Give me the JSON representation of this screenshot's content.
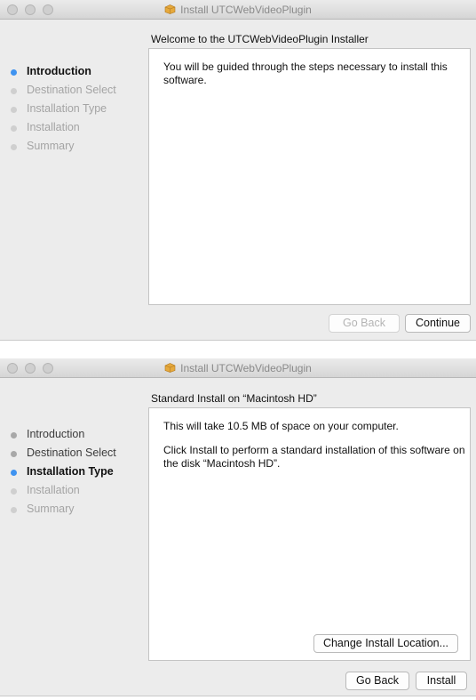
{
  "window1": {
    "title": "Install UTCWebVideoPlugin",
    "steps": [
      "Introduction",
      "Destination Select",
      "Installation Type",
      "Installation",
      "Summary"
    ],
    "pane_title": "Welcome to the UTCWebVideoPlugin Installer",
    "body_text": "You will be guided through the steps necessary to install this software.",
    "back_label": "Go Back",
    "continue_label": "Continue"
  },
  "window2": {
    "title": "Install UTCWebVideoPlugin",
    "steps": [
      "Introduction",
      "Destination Select",
      "Installation Type",
      "Installation",
      "Summary"
    ],
    "pane_title": "Standard Install on “Macintosh HD”",
    "body_text_1": "This will take 10.5 MB of space on your computer.",
    "body_text_2": "Click Install to perform a standard installation of this software on the disk “Macintosh HD”.",
    "change_location_label": "Change Install Location...",
    "back_label": "Go Back",
    "install_label": "Install"
  },
  "colors": {
    "active_step": "#3f93f0",
    "window_bg": "#ececec",
    "pane_bg": "#ffffff"
  },
  "icons": {
    "title_icon": "package-icon"
  }
}
